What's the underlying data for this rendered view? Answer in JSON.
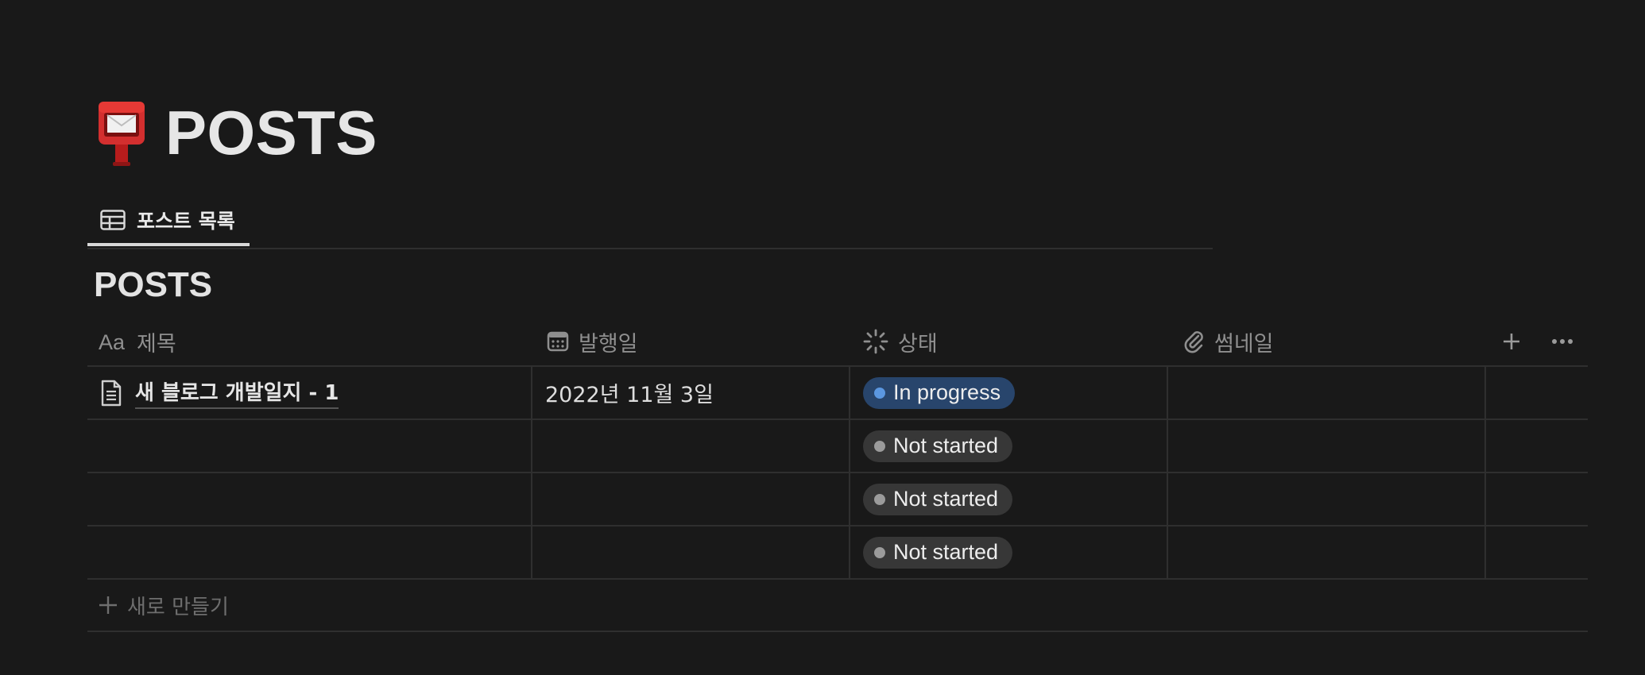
{
  "page": {
    "title": "POSTS",
    "icon": "postbox-icon"
  },
  "tabs": [
    {
      "label": "포스트 목록",
      "icon": "table-icon",
      "active": true
    }
  ],
  "database": {
    "title": "POSTS",
    "columns": [
      {
        "label": "제목",
        "icon": "title-aa-icon"
      },
      {
        "label": "발행일",
        "icon": "calendar-icon"
      },
      {
        "label": "상태",
        "icon": "status-spinner-icon"
      },
      {
        "label": "썸네일",
        "icon": "paperclip-icon"
      }
    ],
    "add_column_icon": "plus-icon",
    "more_icon": "more-horizontal-icon",
    "rows": [
      {
        "title": "새 블로그 개발일지 - 1",
        "date": "2022년 11월 3일",
        "status": "In progress",
        "thumbnail": ""
      },
      {
        "title": "",
        "date": "",
        "status": "Not started",
        "thumbnail": ""
      },
      {
        "title": "",
        "date": "",
        "status": "Not started",
        "thumbnail": ""
      },
      {
        "title": "",
        "date": "",
        "status": "Not started",
        "thumbnail": ""
      }
    ],
    "new_row_label": "새로 만들기"
  },
  "colors": {
    "background": "#191919",
    "in_progress_bg": "#28456c",
    "in_progress_dot": "#5b97e0",
    "not_started_bg": "#373737",
    "not_started_dot": "#9b9b9b"
  }
}
